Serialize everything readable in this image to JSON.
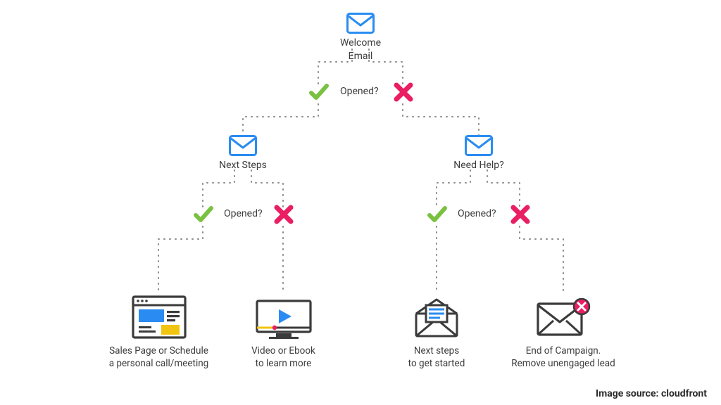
{
  "diagram": {
    "root": {
      "label": "Welcome Email",
      "question": "Opened?"
    },
    "left": {
      "label": "Next Steps",
      "question": "Opened?",
      "yes": {
        "line1": "Sales Page or Schedule",
        "line2": "a personal call/meeting"
      },
      "no": {
        "line1": "Video or Ebook",
        "line2": "to learn more"
      }
    },
    "right": {
      "label": "Need Help?",
      "question": "Opened?",
      "yes": {
        "line1": "Next steps",
        "line2": "to get started"
      },
      "no": {
        "line1": "End of Campaign.",
        "line2": "Remove unengaged lead"
      }
    }
  },
  "credit_prefix": "Image source: ",
  "credit_source": "cloudfront",
  "colors": {
    "blue": "#2a8cf2",
    "green": "#7ac142",
    "pink": "#e91e63",
    "yellow": "#f1c40f",
    "stroke": "#3b3b3b",
    "dot": "#8a8a8a"
  }
}
